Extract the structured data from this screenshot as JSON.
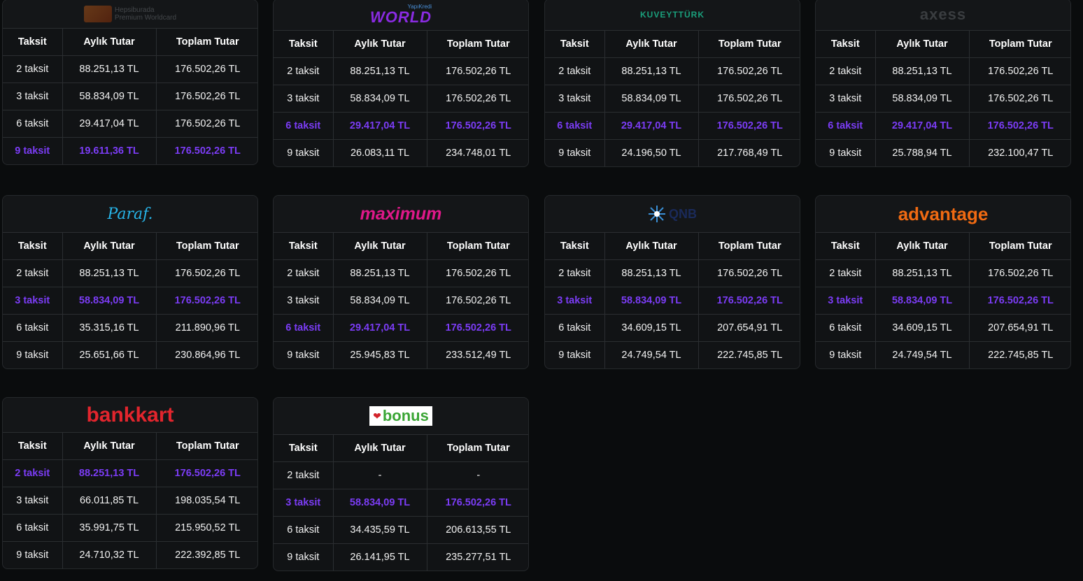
{
  "headers": {
    "c1": "Taksit",
    "c2": "Aylık Tutar",
    "c3": "Toplam Tutar"
  },
  "cards": [
    {
      "logo": "hepsiburada-premium-worldcard",
      "logo_text": [
        "Hepsiburada",
        "Premium Worldcard"
      ],
      "rows": [
        {
          "t": "2 taksit",
          "a": "88.251,13 TL",
          "s": "176.502,26 TL",
          "hl": false
        },
        {
          "t": "3 taksit",
          "a": "58.834,09 TL",
          "s": "176.502,26 TL",
          "hl": false
        },
        {
          "t": "6 taksit",
          "a": "29.417,04 TL",
          "s": "176.502,26 TL",
          "hl": false
        },
        {
          "t": "9 taksit",
          "a": "19.611,36 TL",
          "s": "176.502,26 TL",
          "hl": true
        }
      ]
    },
    {
      "logo": "world",
      "logo_text": [
        "YapıKredi",
        "WORLD"
      ],
      "rows": [
        {
          "t": "2 taksit",
          "a": "88.251,13 TL",
          "s": "176.502,26 TL",
          "hl": false
        },
        {
          "t": "3 taksit",
          "a": "58.834,09 TL",
          "s": "176.502,26 TL",
          "hl": false
        },
        {
          "t": "6 taksit",
          "a": "29.417,04 TL",
          "s": "176.502,26 TL",
          "hl": true
        },
        {
          "t": "9 taksit",
          "a": "26.083,11 TL",
          "s": "234.748,01 TL",
          "hl": false
        }
      ]
    },
    {
      "logo": "kuveyt-turk",
      "logo_text": [
        "KUVEYTTÜRK"
      ],
      "rows": [
        {
          "t": "2 taksit",
          "a": "88.251,13 TL",
          "s": "176.502,26 TL",
          "hl": false
        },
        {
          "t": "3 taksit",
          "a": "58.834,09 TL",
          "s": "176.502,26 TL",
          "hl": false
        },
        {
          "t": "6 taksit",
          "a": "29.417,04 TL",
          "s": "176.502,26 TL",
          "hl": true
        },
        {
          "t": "9 taksit",
          "a": "24.196,50 TL",
          "s": "217.768,49 TL",
          "hl": false
        }
      ]
    },
    {
      "logo": "axess",
      "logo_text": [
        "axess"
      ],
      "rows": [
        {
          "t": "2 taksit",
          "a": "88.251,13 TL",
          "s": "176.502,26 TL",
          "hl": false
        },
        {
          "t": "3 taksit",
          "a": "58.834,09 TL",
          "s": "176.502,26 TL",
          "hl": false
        },
        {
          "t": "6 taksit",
          "a": "29.417,04 TL",
          "s": "176.502,26 TL",
          "hl": true
        },
        {
          "t": "9 taksit",
          "a": "25.788,94 TL",
          "s": "232.100,47 TL",
          "hl": false
        }
      ]
    },
    {
      "logo": "paraf",
      "logo_text": [
        "Paraf."
      ],
      "rows": [
        {
          "t": "2 taksit",
          "a": "88.251,13 TL",
          "s": "176.502,26 TL",
          "hl": false
        },
        {
          "t": "3 taksit",
          "a": "58.834,09 TL",
          "s": "176.502,26 TL",
          "hl": true
        },
        {
          "t": "6 taksit",
          "a": "35.315,16 TL",
          "s": "211.890,96 TL",
          "hl": false
        },
        {
          "t": "9 taksit",
          "a": "25.651,66 TL",
          "s": "230.864,96 TL",
          "hl": false
        }
      ]
    },
    {
      "logo": "maximum",
      "logo_text": [
        "maximum"
      ],
      "rows": [
        {
          "t": "2 taksit",
          "a": "88.251,13 TL",
          "s": "176.502,26 TL",
          "hl": false
        },
        {
          "t": "3 taksit",
          "a": "58.834,09 TL",
          "s": "176.502,26 TL",
          "hl": false
        },
        {
          "t": "6 taksit",
          "a": "29.417,04 TL",
          "s": "176.502,26 TL",
          "hl": true
        },
        {
          "t": "9 taksit",
          "a": "25.945,83 TL",
          "s": "233.512,49 TL",
          "hl": false
        }
      ]
    },
    {
      "logo": "qnb",
      "logo_text": [
        "QNB"
      ],
      "rows": [
        {
          "t": "2 taksit",
          "a": "88.251,13 TL",
          "s": "176.502,26 TL",
          "hl": false
        },
        {
          "t": "3 taksit",
          "a": "58.834,09 TL",
          "s": "176.502,26 TL",
          "hl": true
        },
        {
          "t": "6 taksit",
          "a": "34.609,15 TL",
          "s": "207.654,91 TL",
          "hl": false
        },
        {
          "t": "9 taksit",
          "a": "24.749,54 TL",
          "s": "222.745,85 TL",
          "hl": false
        }
      ]
    },
    {
      "logo": "advantage",
      "logo_text": [
        "advantage"
      ],
      "rows": [
        {
          "t": "2 taksit",
          "a": "88.251,13 TL",
          "s": "176.502,26 TL",
          "hl": false
        },
        {
          "t": "3 taksit",
          "a": "58.834,09 TL",
          "s": "176.502,26 TL",
          "hl": true
        },
        {
          "t": "6 taksit",
          "a": "34.609,15 TL",
          "s": "207.654,91 TL",
          "hl": false
        },
        {
          "t": "9 taksit",
          "a": "24.749,54 TL",
          "s": "222.745,85 TL",
          "hl": false
        }
      ]
    },
    {
      "logo": "bankkart",
      "logo_text": [
        "bankkart"
      ],
      "rows": [
        {
          "t": "2 taksit",
          "a": "88.251,13 TL",
          "s": "176.502,26 TL",
          "hl": true
        },
        {
          "t": "3 taksit",
          "a": "66.011,85 TL",
          "s": "198.035,54 TL",
          "hl": false
        },
        {
          "t": "6 taksit",
          "a": "35.991,75 TL",
          "s": "215.950,52 TL",
          "hl": false
        },
        {
          "t": "9 taksit",
          "a": "24.710,32 TL",
          "s": "222.392,85 TL",
          "hl": false
        }
      ]
    },
    {
      "logo": "bonus",
      "logo_text": [
        "bonus"
      ],
      "rows": [
        {
          "t": "2 taksit",
          "a": "-",
          "s": "-",
          "hl": false
        },
        {
          "t": "3 taksit",
          "a": "58.834,09 TL",
          "s": "176.502,26 TL",
          "hl": true
        },
        {
          "t": "6 taksit",
          "a": "34.435,59 TL",
          "s": "206.613,55 TL",
          "hl": false
        },
        {
          "t": "9 taksit",
          "a": "26.141,95 TL",
          "s": "235.277,51 TL",
          "hl": false
        }
      ]
    }
  ],
  "colors": {
    "highlight": "#7b3cf5",
    "background": "#0a0c0d",
    "card": "#111315",
    "border": "#2b2e31"
  }
}
